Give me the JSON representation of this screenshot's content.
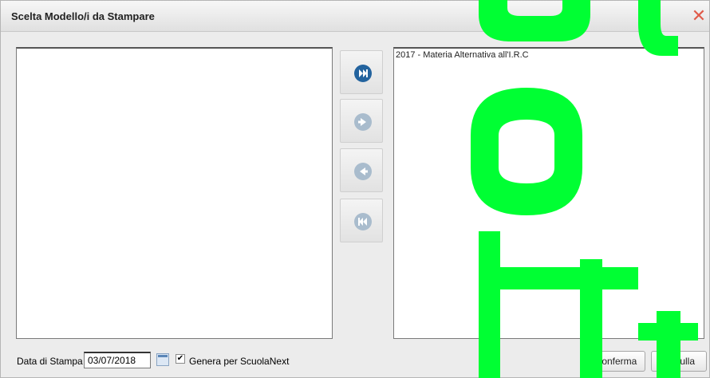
{
  "dialog": {
    "title": "Scelta Modello/i da Stampare",
    "close_glyph": "✕"
  },
  "lists": {
    "available": [],
    "selected": [
      "2017 - Materia Alternativa all'I.R.C"
    ]
  },
  "move_buttons": [
    {
      "icon": "move-all-right-icon",
      "enabled": true
    },
    {
      "icon": "move-right-icon",
      "enabled": false
    },
    {
      "icon": "move-left-icon",
      "enabled": false
    },
    {
      "icon": "move-all-left-icon",
      "enabled": false
    }
  ],
  "footer": {
    "date_label": "Data di Stampa",
    "date_value": "03/07/2018",
    "checkbox_checked": true,
    "checkbox_label": "Genera per ScuolaNext",
    "confirm_label": "Conferma",
    "cancel_label": "Annulla"
  },
  "colors": {
    "active_icon": "#1f5c96",
    "disabled_icon": "#9fb2c4",
    "close": "#e05b4a",
    "watermark": "#00ff33"
  }
}
